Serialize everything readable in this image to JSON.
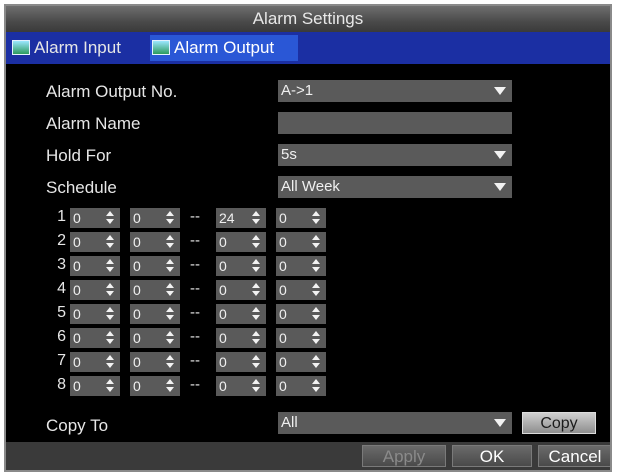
{
  "window": {
    "title": "Alarm Settings"
  },
  "tabs": [
    {
      "label": "Alarm Input",
      "icon": "alarm-input-icon",
      "active": false
    },
    {
      "label": "Alarm Output",
      "icon": "alarm-output-icon",
      "active": true
    }
  ],
  "form": {
    "alarm_output_no": {
      "label": "Alarm Output No.",
      "value": "A->1"
    },
    "alarm_name": {
      "label": "Alarm Name",
      "value": ""
    },
    "hold_for": {
      "label": "Hold For",
      "value": "5s"
    },
    "schedule": {
      "label": "Schedule",
      "value": "All Week"
    }
  },
  "schedule_rows": [
    {
      "num": "1",
      "start_hour": "0",
      "start_min": "0",
      "sep": "--",
      "end_hour": "24",
      "end_min": "0"
    },
    {
      "num": "2",
      "start_hour": "0",
      "start_min": "0",
      "sep": "--",
      "end_hour": "0",
      "end_min": "0"
    },
    {
      "num": "3",
      "start_hour": "0",
      "start_min": "0",
      "sep": "--",
      "end_hour": "0",
      "end_min": "0"
    },
    {
      "num": "4",
      "start_hour": "0",
      "start_min": "0",
      "sep": "--",
      "end_hour": "0",
      "end_min": "0"
    },
    {
      "num": "5",
      "start_hour": "0",
      "start_min": "0",
      "sep": "--",
      "end_hour": "0",
      "end_min": "0"
    },
    {
      "num": "6",
      "start_hour": "0",
      "start_min": "0",
      "sep": "--",
      "end_hour": "0",
      "end_min": "0"
    },
    {
      "num": "7",
      "start_hour": "0",
      "start_min": "0",
      "sep": "--",
      "end_hour": "0",
      "end_min": "0"
    },
    {
      "num": "8",
      "start_hour": "0",
      "start_min": "0",
      "sep": "--",
      "end_hour": "0",
      "end_min": "0"
    }
  ],
  "copy_to": {
    "label": "Copy To",
    "value": "All",
    "button": "Copy"
  },
  "footer": {
    "apply": "Apply",
    "ok": "OK",
    "cancel": "Cancel"
  }
}
